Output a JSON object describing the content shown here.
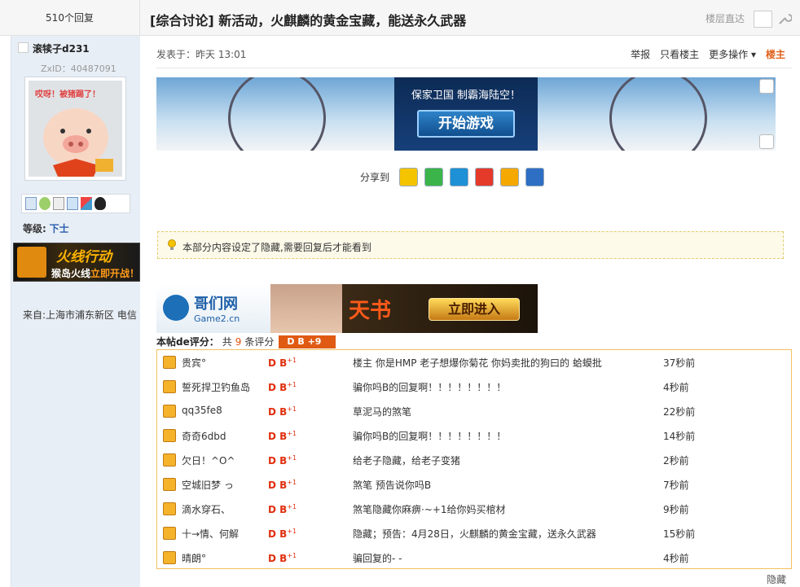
{
  "topbar": {
    "reply_count": "510个回复",
    "category": "[综合讨论]",
    "title": "新活动，火麒麟的黄金宝藏，能送永久武器",
    "floor_jump_label": "楼层直达"
  },
  "user": {
    "name": "滚犊子d231",
    "zxid": "ZxID：40487091",
    "avatar_caption": "哎呀！被猪踢了！",
    "level_label": "等级:",
    "level_value": "下士",
    "from": "来自:上海市浦东新区 电信"
  },
  "side_ad": {
    "title": "火线行动",
    "sub_prefix": "猴岛火线",
    "sub_highlight": "立即开战！"
  },
  "post": {
    "posted_at": "发表于：昨天  13:01",
    "actions": [
      "举报",
      "只看楼主",
      "更多操作 ▾"
    ],
    "owner_label": "楼主"
  },
  "ad_banner": {
    "slogan": "保家卫国  制霸海陆空！",
    "button": "开始游戏"
  },
  "share": {
    "label": "分享到",
    "icons": [
      "qq-icon",
      "wechat-icon",
      "pengyou-icon",
      "weibo-icon",
      "qzone-icon",
      "tieba-icon"
    ],
    "colors": [
      "#f5c400",
      "#3bb54a",
      "#1e90d6",
      "#e53a2a",
      "#f5a800",
      "#2e6fc4"
    ]
  },
  "hidden_notice": "本部分内容设定了隐藏,需要回复后才能看到",
  "game2_ad": {
    "name": "哥们网",
    "domain": "Game2.cn",
    "game_title": "天书",
    "button": "立即进入"
  },
  "ratings": {
    "summary_label": "本帖de评分：",
    "count_prefix": "共",
    "count": "9",
    "count_suffix": "条评分",
    "badge": "D B  +9",
    "rows": [
      {
        "name": "贵宾°",
        "score": "D B",
        "delta": "+1",
        "reason": "楼主  你是HMP   老子想爆你菊花  你妈卖批的狗曰的   蛤蟆批",
        "time": "37秒前"
      },
      {
        "name": "誓死捍卫钓鱼岛",
        "score": "D B",
        "delta": "+1",
        "reason": "骗你吗B的回复啊！！！！！！！！",
        "time": "4秒前"
      },
      {
        "name": "qq35fe8",
        "score": "D B",
        "delta": "+1",
        "reason": "草泥马的煞笔",
        "time": "22秒前"
      },
      {
        "name": "奇奇6dbd",
        "score": "D B",
        "delta": "+1",
        "reason": "骗你吗B的回复啊！！！！！！！！",
        "time": "14秒前"
      },
      {
        "name": "欠日！^O^",
        "score": "D B",
        "delta": "+1",
        "reason": "给老子隐藏，给老子变猪",
        "time": "2秒前"
      },
      {
        "name": "空城旧梦  っ",
        "score": "D B",
        "delta": "+1",
        "reason": "煞笔  预告说你吗B",
        "time": "7秒前"
      },
      {
        "name": "滴水穿石、",
        "score": "D B",
        "delta": "+1",
        "reason": "煞笔隐藏你麻痹·~+1给你妈买棺材",
        "time": "9秒前"
      },
      {
        "name": "十→情、何解",
        "score": "D B",
        "delta": "+1",
        "reason": "隐藏；预告：4月28日，火麒麟的黄金宝藏，送永久武器",
        "time": "15秒前"
      },
      {
        "name": "晴朗°",
        "score": "D B",
        "delta": "+1",
        "reason": "骗回复的- -",
        "time": "4秒前"
      }
    ]
  },
  "hide_link": "隐藏"
}
